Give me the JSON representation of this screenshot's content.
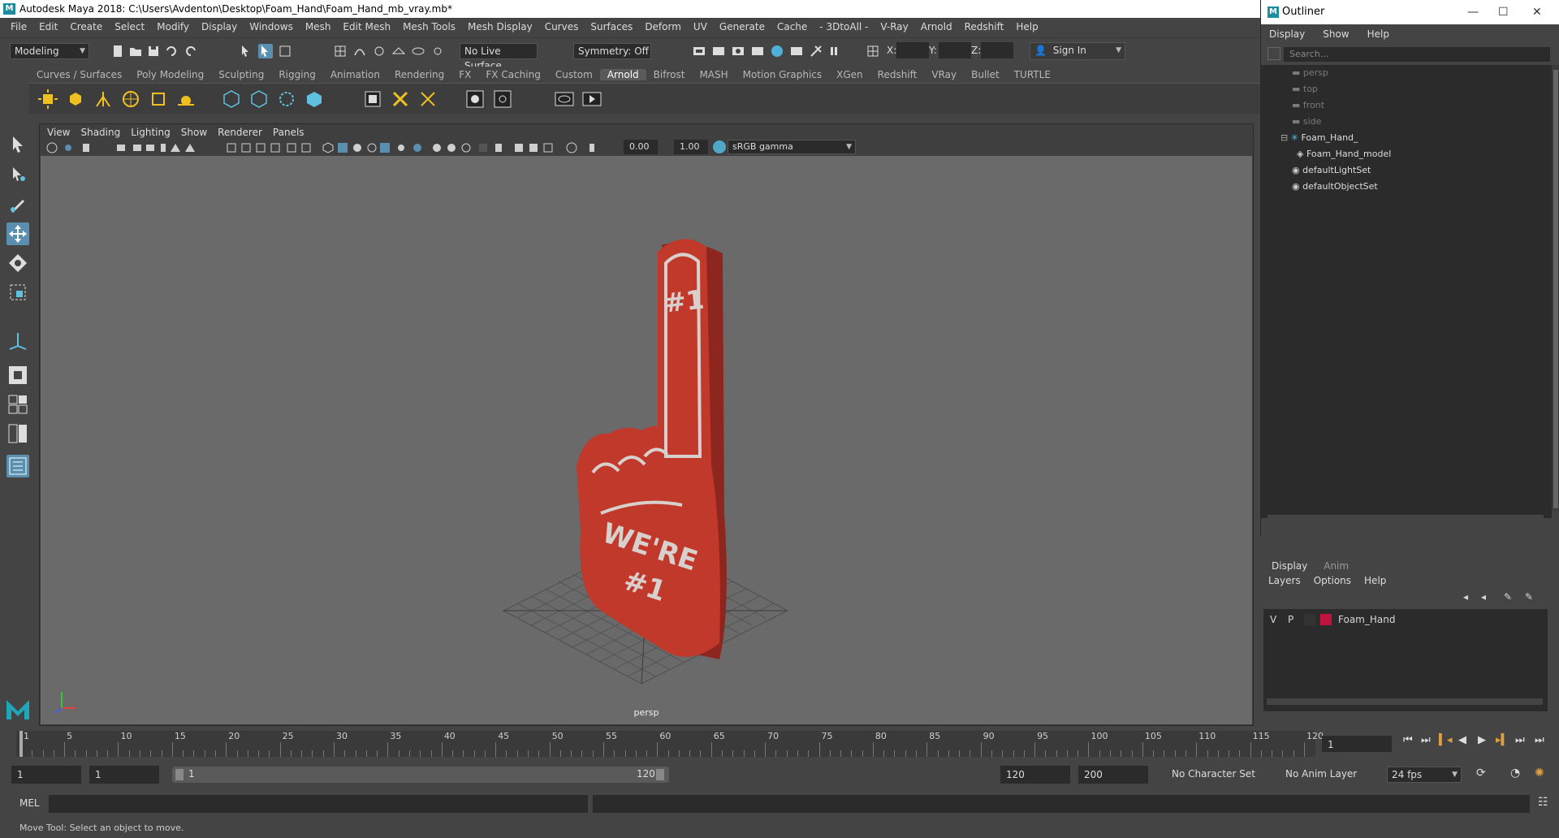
{
  "window": {
    "title": "Autodesk Maya 2018: C:\\Users\\Avdenton\\Desktop\\Foam_Hand\\Foam_Hand_mb_vray.mb*",
    "logo_letter": "M"
  },
  "menubar": [
    "File",
    "Edit",
    "Create",
    "Select",
    "Modify",
    "Display",
    "Windows",
    "Mesh",
    "Edit Mesh",
    "Mesh Tools",
    "Mesh Display",
    "Curves",
    "Surfaces",
    "Deform",
    "UV",
    "Generate",
    "Cache",
    "- 3DtoAll -",
    "V-Ray",
    "Arnold",
    "Redshift",
    "Help"
  ],
  "statusline": {
    "mode": "Modeling",
    "live_surface": "No Live Surface",
    "symmetry": "Symmetry: Off",
    "x_label": "X:",
    "y_label": "Y:",
    "z_label": "Z:",
    "sign_in": "Sign In"
  },
  "shelf": {
    "tabs": [
      "Curves / Surfaces",
      "Poly Modeling",
      "Sculpting",
      "Rigging",
      "Animation",
      "Rendering",
      "FX",
      "FX Caching",
      "Custom",
      "Arnold",
      "Bifrost",
      "MASH",
      "Motion Graphics",
      "XGen",
      "Redshift",
      "VRay",
      "Bullet",
      "TURTLE"
    ],
    "active_tab": "Arnold"
  },
  "panel": {
    "menu": [
      "View",
      "Shading",
      "Lighting",
      "Show",
      "Renderer",
      "Panels"
    ],
    "exposure": "0.00",
    "gamma": "1.00",
    "color_space": "sRGB gamma",
    "camera_label": "persp"
  },
  "model": {
    "text_number": "#1",
    "text_slogan_line1": "WE'RE",
    "text_slogan_line2": "#1",
    "color": "#c0392b"
  },
  "outliner": {
    "title": "Outliner",
    "menu": [
      "Display",
      "Show",
      "Help"
    ],
    "search_placeholder": "Search...",
    "items": [
      {
        "label": "persp",
        "dim": true
      },
      {
        "label": "top",
        "dim": true
      },
      {
        "label": "front",
        "dim": true
      },
      {
        "label": "side",
        "dim": true
      },
      {
        "label": "Foam_Hand_",
        "dim": false
      },
      {
        "label": "Foam_Hand_model",
        "dim": false
      },
      {
        "label": "defaultLightSet",
        "dim": false
      },
      {
        "label": "defaultObjectSet",
        "dim": false
      }
    ]
  },
  "layers": {
    "tabs": [
      "Display",
      "Anim"
    ],
    "menu": [
      "Layers",
      "Options",
      "Help"
    ],
    "row": {
      "v": "V",
      "p": "P",
      "name": "Foam_Hand",
      "color": "#c0143c"
    }
  },
  "timeline": {
    "ticks": [
      "1",
      "5",
      "10",
      "15",
      "20",
      "25",
      "30",
      "35",
      "40",
      "45",
      "50",
      "55",
      "60",
      "65",
      "70",
      "75",
      "80",
      "85",
      "90",
      "95",
      "100",
      "105",
      "110",
      "115",
      "120"
    ],
    "current_frame": "1"
  },
  "range": {
    "start": "1",
    "anim_start": "1",
    "range_start_label": "1",
    "range_end_label": "120",
    "playback_end": "120",
    "anim_end": "200",
    "character_set": "No Character Set",
    "anim_layer": "No Anim Layer",
    "fps": "24 fps"
  },
  "cmdline": {
    "label": "MEL"
  },
  "helpline": {
    "text": "Move Tool: Select an object to move."
  }
}
